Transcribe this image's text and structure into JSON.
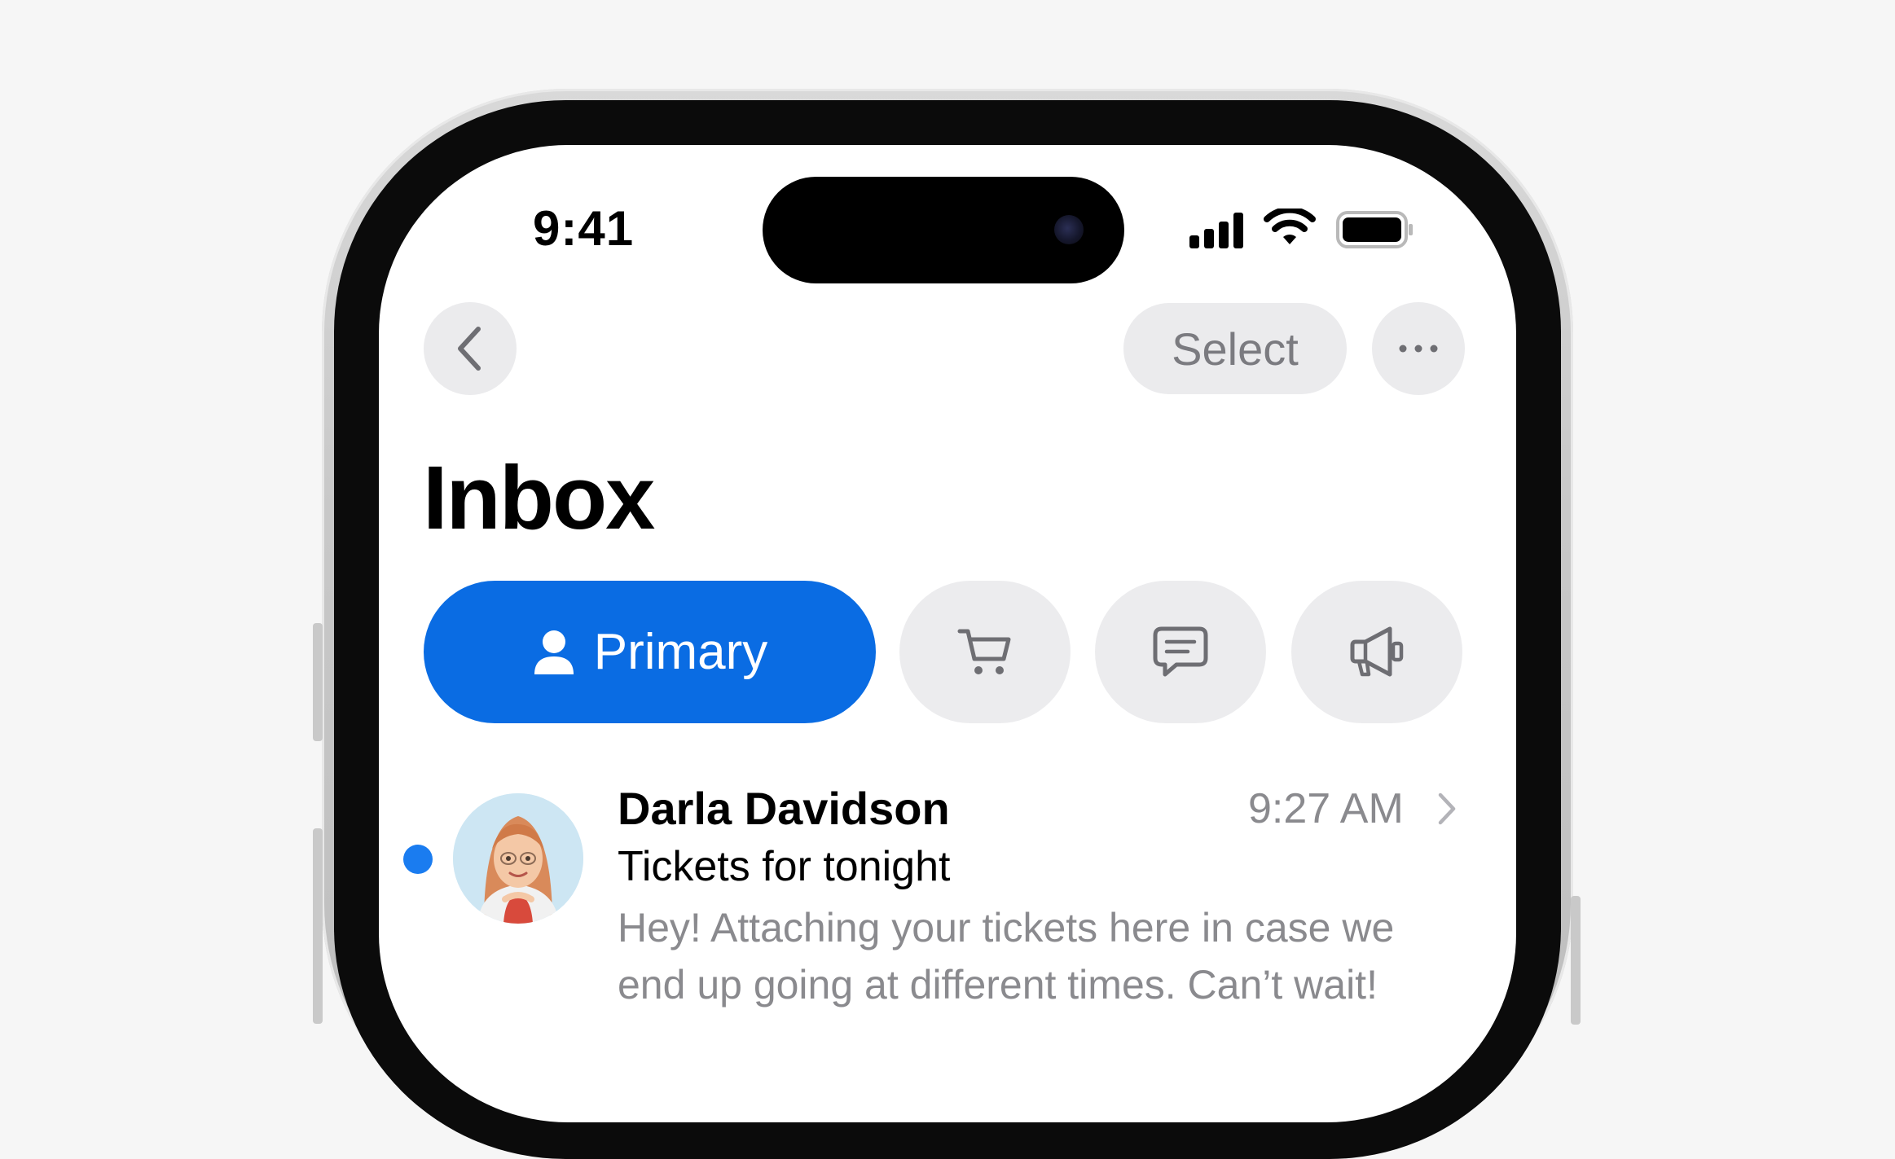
{
  "status_bar": {
    "time": "9:41"
  },
  "nav": {
    "back_icon": "chevron-left-icon",
    "select_label": "Select",
    "more_icon": "ellipsis-icon"
  },
  "title": "Inbox",
  "tabs": [
    {
      "label": "Primary",
      "icon": "person-icon",
      "selected": true
    },
    {
      "label": "",
      "icon": "cart-icon",
      "selected": false
    },
    {
      "label": "",
      "icon": "chat-bubble-icon",
      "selected": false
    },
    {
      "label": "",
      "icon": "megaphone-icon",
      "selected": false
    }
  ],
  "messages": [
    {
      "sender": "Darla Davidson",
      "time": "9:27 AM",
      "subject": "Tickets for tonight",
      "preview_line1": "Hey! Attaching your tickets here in case we",
      "preview_line2": "end up going at different times. Can’t wait!",
      "unread": true
    }
  ],
  "colors": {
    "accent": "#0a6ce3",
    "unread_dot": "#1a7cf0",
    "secondary_text": "#8a8a8e",
    "chip_bg": "#ebebed"
  }
}
